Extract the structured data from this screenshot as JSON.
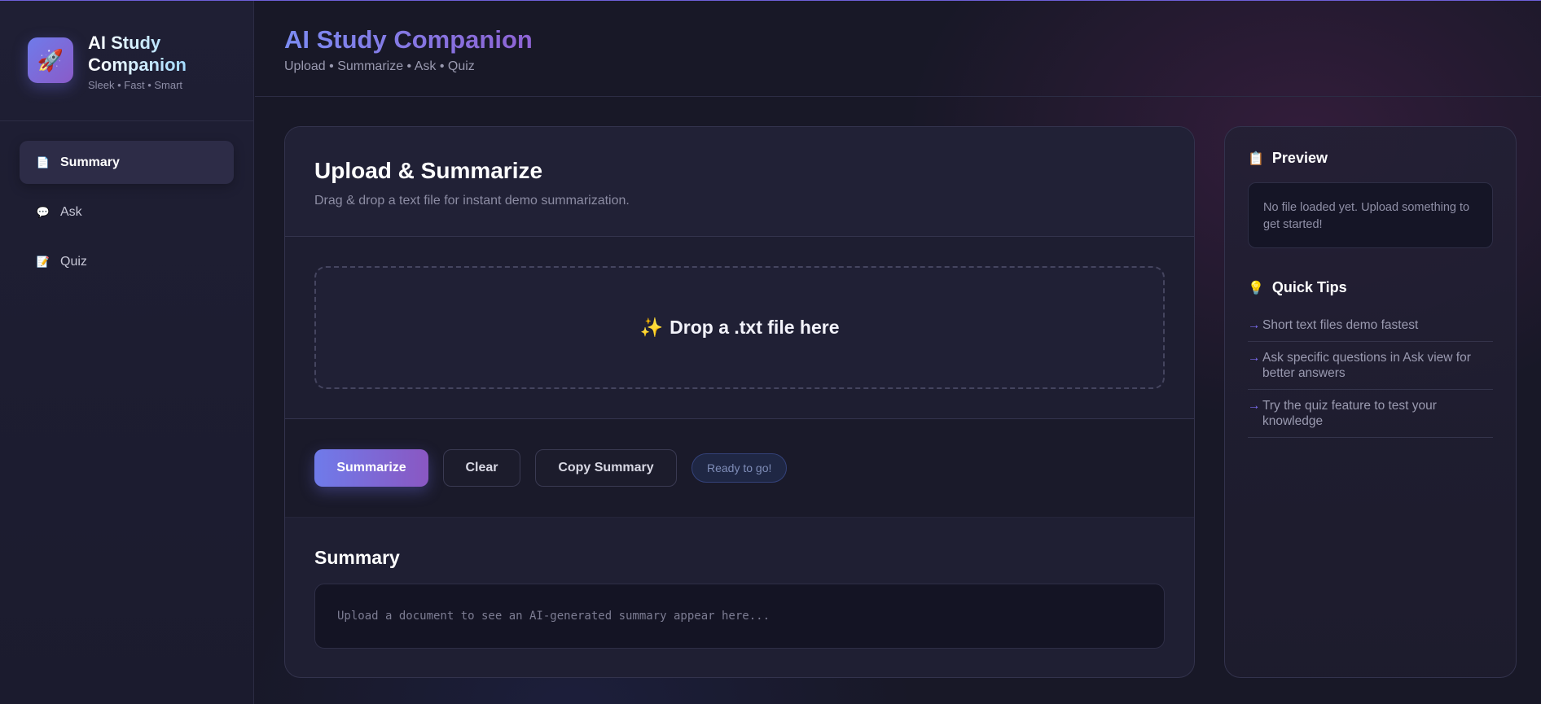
{
  "brand": {
    "icon": "rocket-icon",
    "title": "AI Study Companion",
    "subtitle": "Sleek • Fast • Smart"
  },
  "nav": {
    "items": [
      {
        "label": "Summary",
        "icon": "document-icon",
        "active": true
      },
      {
        "label": "Ask",
        "icon": "speech-bubble-icon",
        "active": false
      },
      {
        "label": "Quiz",
        "icon": "memo-icon",
        "active": false
      }
    ]
  },
  "header": {
    "title": "AI Study Companion",
    "subtitle": "Upload • Summarize • Ask • Quiz"
  },
  "upload": {
    "title": "Upload & Summarize",
    "description": "Drag & drop a text file for instant demo summarization.",
    "dropzone_label": "Drop a .txt file here",
    "dropzone_icon": "sparkles-icon"
  },
  "actions": {
    "summarize_label": "Summarize",
    "clear_label": "Clear",
    "copy_label": "Copy Summary",
    "status": "Ready to go!"
  },
  "summary": {
    "title": "Summary",
    "placeholder": "Upload a document to see an AI-generated summary appear here..."
  },
  "preview": {
    "title": "Preview",
    "icon": "clipboard-icon",
    "empty_text": "No file loaded yet. Upload something to get started!"
  },
  "tips": {
    "title": "Quick Tips",
    "icon": "lightbulb-icon",
    "items": [
      "Short text files demo fastest",
      "Ask specific questions in Ask view for better answers",
      "Try the quiz feature to test your knowledge"
    ]
  },
  "colors": {
    "accent": "#6f7bea",
    "accent_end": "#8a57c2",
    "background": "#181827"
  }
}
